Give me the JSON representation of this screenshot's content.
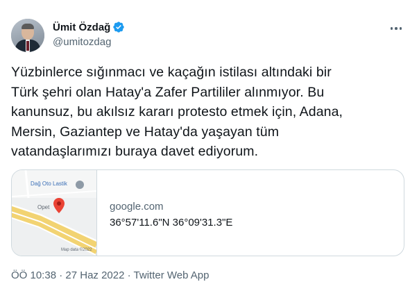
{
  "author": {
    "display_name": "Ümit Özdağ",
    "handle": "@umitozdag",
    "avatar_icon": "profile-photo",
    "verified_icon": "verified-badge-icon",
    "verified_color": "#1d9bf0"
  },
  "more_icon": "more-horizontal-icon",
  "tweet_text": "Yüzbinlerce sığınmacı ve kaçağın istilası altındaki bir\nTürk şehri olan Hatay'a Zafer Partililer alınmıyor. Bu\nkanunsuz, bu akılsız kararı protesto etmek için, Adana,\nMersin, Gaziantep ve Hatay'da yaşayan tüm\nvatandaşlarımızı buraya davet ediyorum.",
  "card": {
    "map_labels": {
      "place_top": "Dağ Oto Lastik",
      "place_left": "Opet",
      "attribution": "Map data ©2022"
    },
    "domain": "google.com",
    "coordinates": "36°57'11.6\"N 36°09'31.3\"E",
    "pin_color": "#ea4335"
  },
  "meta": {
    "time": "ÖÖ 10:38",
    "separator1": " · ",
    "date": "27 Haz 2022",
    "separator2": " · ",
    "source": "Twitter Web App"
  }
}
